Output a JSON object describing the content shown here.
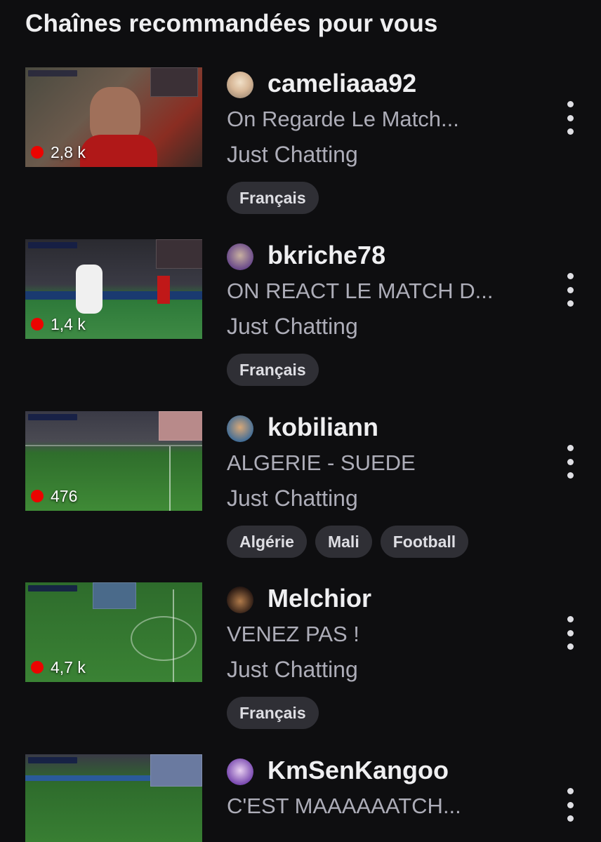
{
  "section": {
    "title": "Chaînes recommandées pour vous"
  },
  "colors": {
    "background": "#0e0e10",
    "live": "#eb0400",
    "tag_bg": "#2f2f35",
    "muted_text": "#adadb8"
  },
  "channels": [
    {
      "name": "cameliaaa92",
      "title": "On Regarde Le Match...",
      "category": "Just Chatting",
      "viewers": "2,8 k",
      "tags": [
        "Français"
      ]
    },
    {
      "name": "bkriche78",
      "title": "ON REACT LE MATCH D...",
      "category": "Just Chatting",
      "viewers": "1,4 k",
      "tags": [
        "Français"
      ]
    },
    {
      "name": "kobiliann",
      "title": "ALGERIE - SUEDE",
      "category": "Just Chatting",
      "viewers": "476",
      "tags": [
        "Algérie",
        "Mali",
        "Football"
      ]
    },
    {
      "name": "Melchior",
      "title": "VENEZ PAS !",
      "category": "Just Chatting",
      "viewers": "4,7 k",
      "tags": [
        "Français"
      ]
    },
    {
      "name": "KmSenKangoo",
      "title": "C'EST MAAAAAATCH...",
      "category": "Just Chatting",
      "viewers": "",
      "tags": []
    }
  ]
}
